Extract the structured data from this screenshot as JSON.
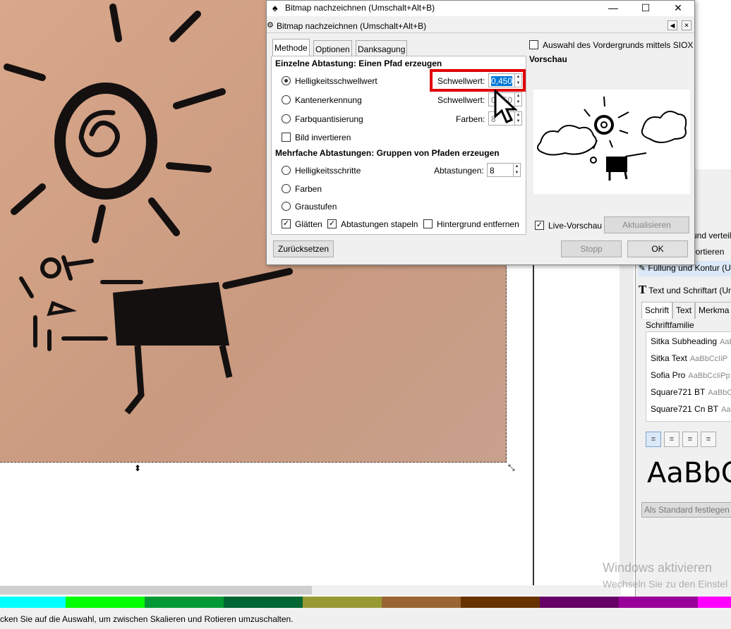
{
  "dialog": {
    "window_title": "Bitmap nachzeichnen (Umschalt+Alt+B)",
    "subheader_title": "Bitmap nachzeichnen (Umschalt+Alt+B)",
    "window_controls": {
      "minimize": "—",
      "maximize": "☐",
      "close": "✕"
    },
    "tabs": [
      {
        "label": "Methode",
        "active": true
      },
      {
        "label": "Optionen",
        "active": false
      },
      {
        "label": "Danksagung",
        "active": false
      }
    ],
    "single_scan": {
      "heading": "Einzelne Abtastung: Einen Pfad erzeugen",
      "brightness": {
        "label": "Helligkeitsschwellwert",
        "selected": true,
        "param_label": "Schwellwert:",
        "value": "0,450"
      },
      "edge": {
        "label": "Kantenerkennung",
        "param_label": "Schwellwert:",
        "value": "0,650"
      },
      "color_quant": {
        "label": "Farbquantisierung",
        "param_label": "Farben:",
        "value": "8"
      },
      "invert": {
        "label": "Bild invertieren",
        "checked": false
      }
    },
    "multi_scan": {
      "heading": "Mehrfache Abtastungen: Gruppen von Pfaden erzeugen",
      "brightness_steps": {
        "label": "Helligkeitsschritte",
        "param_label": "Abtastungen:",
        "value": "8"
      },
      "colors": {
        "label": "Farben"
      },
      "grays": {
        "label": "Graustufen"
      },
      "smooth": {
        "label": "Glätten",
        "checked": true
      },
      "stack": {
        "label": "Abtastungen stapeln",
        "checked": true
      },
      "remove_bg": {
        "label": "Hintergrund entfernen",
        "checked": false
      }
    },
    "siox": {
      "label": "Auswahl des Vordergrunds mittels SIOX",
      "checked": false
    },
    "preview_heading": "Vorschau",
    "live_preview": {
      "label": "Live-Vorschau",
      "checked": true
    },
    "buttons": {
      "update": "Aktualisieren",
      "reset": "Zurücksetzen",
      "stop": "Stopp",
      "ok": "OK"
    }
  },
  "dock": {
    "rows": [
      "und verteil",
      "portieren",
      "Füllung und Kontur (U",
      "Text und Schriftart (Um"
    ],
    "tabs": [
      "Schrift",
      "Text",
      "Merkma"
    ],
    "font_family_label": "Schriftfamilie",
    "fonts": [
      {
        "name": "Sitka Subheading",
        "sample": "AaB"
      },
      {
        "name": "Sitka Text",
        "sample": "AaBbCcIiP"
      },
      {
        "name": "Sofia Pro",
        "sample": "AaBbCcIiPp"
      },
      {
        "name": "Square721 BT",
        "sample": "AaBbC"
      },
      {
        "name": "Square721 Cn BT",
        "sample": "AaB"
      }
    ],
    "sample_text": "AaBbCc",
    "set_default_button": "Als Standard festlegen"
  },
  "statusbar": {
    "message": "cken Sie auf die Auswahl, um zwischen Skalieren und Rotieren umzuschalten."
  },
  "watermark": {
    "line1": "Windows aktivieren",
    "line2": "Wechseln Sie zu den Einstel"
  },
  "palette": [
    "#00ffff",
    "#00ff00",
    "#009933",
    "#006633",
    "#999933",
    "#996633",
    "#663300",
    "#660066",
    "#990099",
    "#ff00ff"
  ],
  "colors": {
    "highlight": "#e00000",
    "selection": "#0078d7"
  }
}
